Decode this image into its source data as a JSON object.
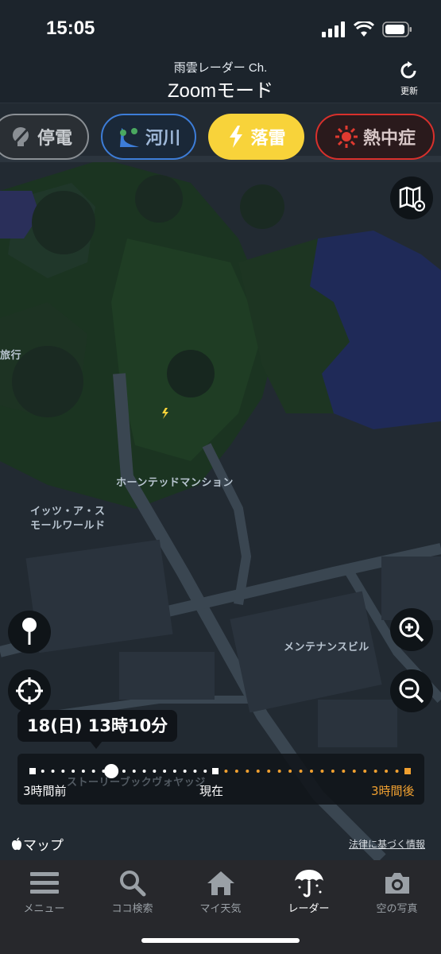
{
  "status_bar": {
    "time": "15:05"
  },
  "header": {
    "subtitle": "雨雲レーダー Ch.",
    "title": "Zoomモード",
    "refresh_label": "更新"
  },
  "chips": [
    {
      "label": "停電",
      "icon": "power-outage-icon",
      "color": "#8a8f94",
      "active": false
    },
    {
      "label": "河川",
      "icon": "river-icon",
      "color": "#3d7dd8",
      "active": false
    },
    {
      "label": "落雷",
      "icon": "lightning-icon",
      "color": "#f8d33a",
      "active": true
    },
    {
      "label": "熱中症",
      "icon": "heatstroke-icon",
      "color": "#d8302c",
      "active": false
    }
  ],
  "map": {
    "labels": {
      "travel": "旅行",
      "haunted_mansion": "ホーンテッドマンション",
      "small_world": "イッツ・ア・ス\nモールワールド",
      "maintenance": "メンテナンスビル",
      "storybook": "ストーリーブックヴォヤッジ"
    },
    "colors": {
      "water": "#1f2a58",
      "grass": "#1c3822",
      "road": "#3a4651",
      "block": "#262f38"
    }
  },
  "timeline": {
    "bubble": "18(日) 13時10分",
    "start_label": "3時間前",
    "now_label": "現在",
    "end_label": "3時間後",
    "past_color": "#ffffff",
    "future_color": "#f0a030",
    "position": 0.21
  },
  "attribution": {
    "apple_maps": "マップ",
    "legal": "法律に基づく情報"
  },
  "tabbar": {
    "items": [
      {
        "label": "メニュー",
        "icon": "menu-icon",
        "active": false
      },
      {
        "label": "ココ検索",
        "icon": "search-icon",
        "active": false
      },
      {
        "label": "マイ天気",
        "icon": "home-icon",
        "active": false
      },
      {
        "label": "レーダー",
        "icon": "umbrella-icon",
        "active": true
      },
      {
        "label": "空の写真",
        "icon": "camera-icon",
        "active": false
      }
    ]
  }
}
